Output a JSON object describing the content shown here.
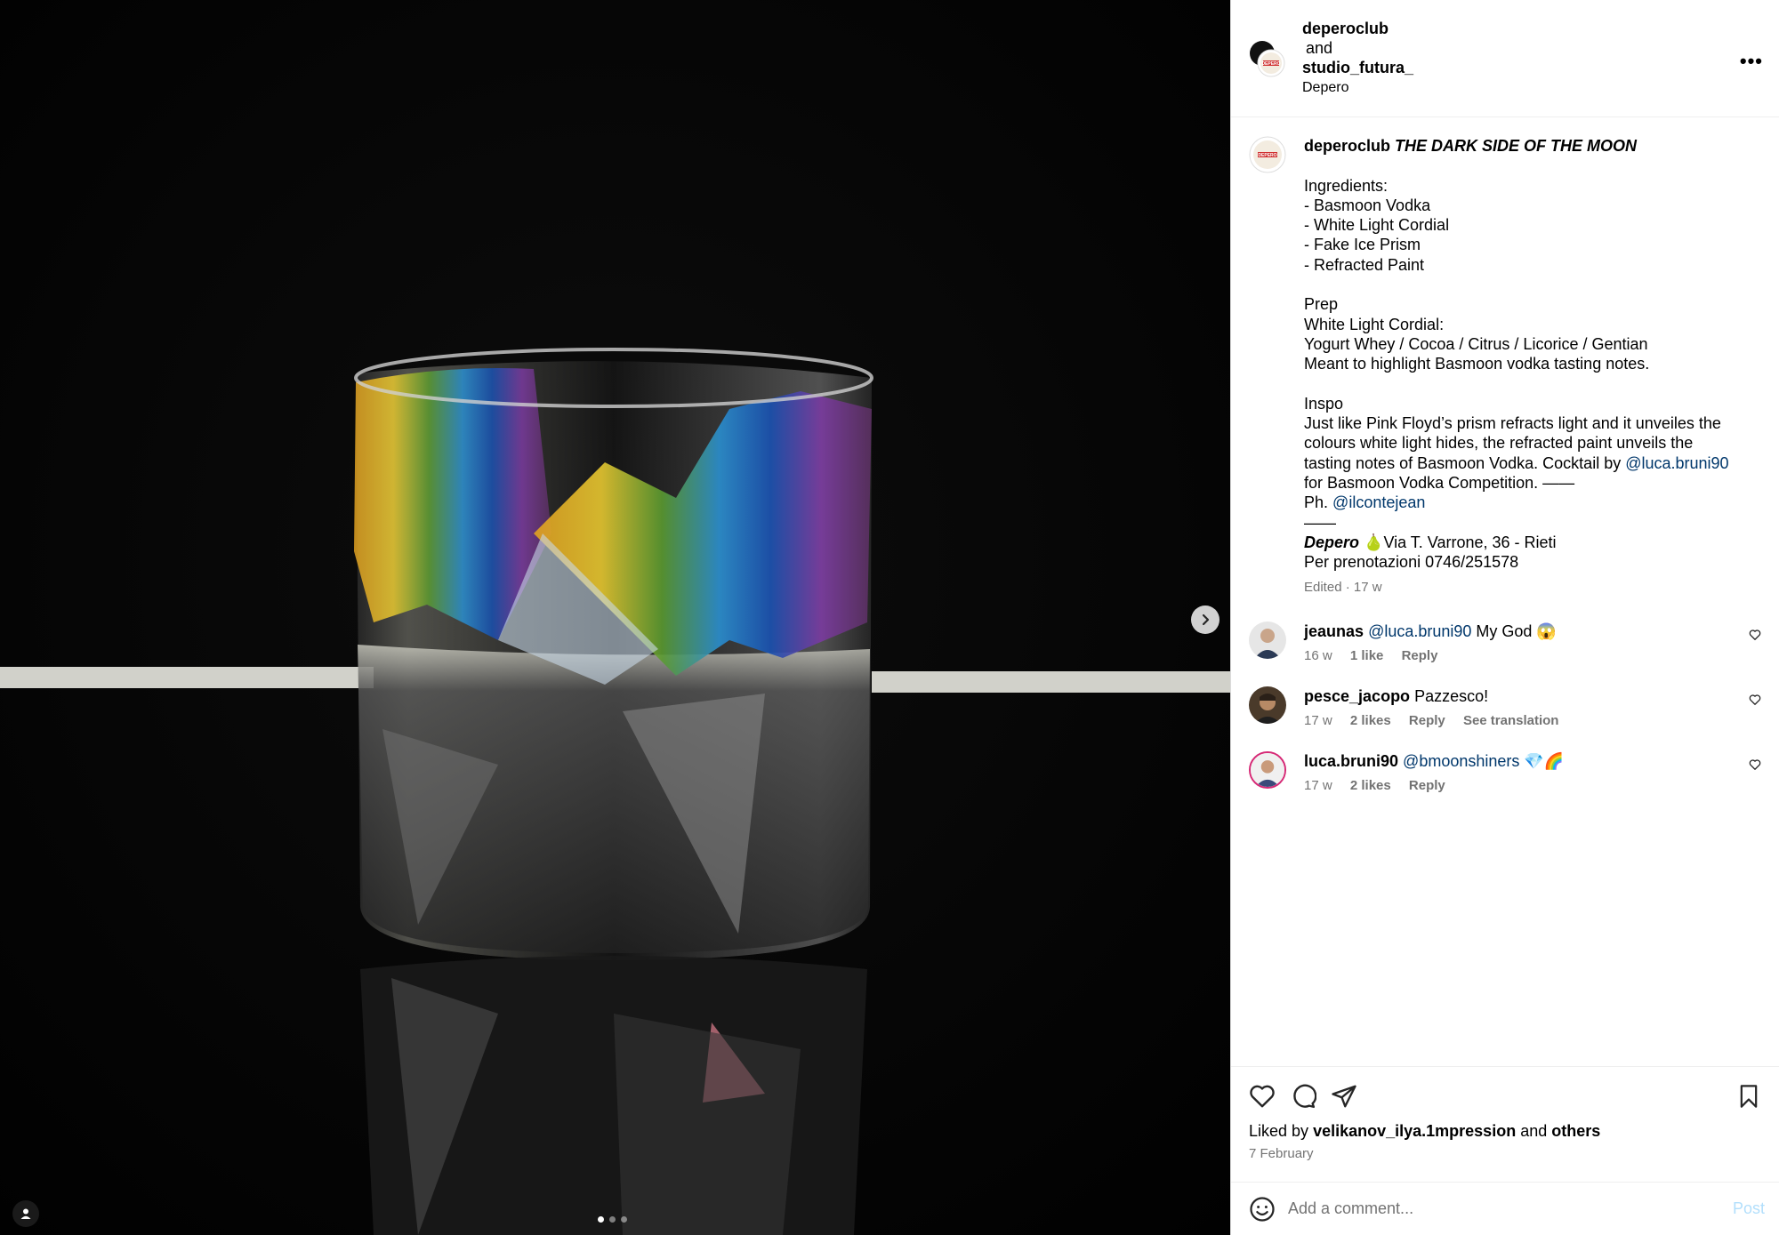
{
  "header": {
    "user1": "deperoclub",
    "and": "and",
    "user2": "studio_futura_",
    "location": "Depero",
    "more_label": "•••"
  },
  "caption": {
    "username": "deperoclub",
    "title": "THE DARK SIDE OF THE MOON",
    "lines": [
      "Ingredients:",
      "- Basmoon Vodka",
      "- White Light Cordial",
      "- Fake Ice Prism",
      "- Refracted Paint",
      "",
      "Prep",
      "White Light Cordial:",
      "Yogurt Whey / Cocoa / Citrus / Licorice / Gentian",
      "Meant to highlight Basmoon vodka tasting notes.",
      "",
      "Inspo",
      "Just like Pink Floyd’s prism refracts light and it unveiles the",
      "colours white light hides, the refracted paint unveils the",
      "tasting notes of Basmoon Vodka. Cocktail by"
    ],
    "mention1": "@luca.bruni90",
    "line_after_mention1": "for Basmoon Vodka Competition. ——",
    "ph_prefix": "Ph.",
    "mention2": "@ilcontejean",
    "divider": "——",
    "venue_name": "Depero",
    "venue_address": "🍐Via T. Varrone, 36 - Rieti",
    "booking": "Per prenotazioni 0746/251578",
    "meta": "Edited · 17 w"
  },
  "comments": [
    {
      "username": "jeaunas",
      "mention": "@luca.bruni90",
      "text": " My God 😱",
      "time": "16 w",
      "likes": "1 like",
      "reply": "Reply",
      "extra": ""
    },
    {
      "username": "pesce_jacopo",
      "mention": "",
      "text": "Pazzesco!",
      "time": "17 w",
      "likes": "2 likes",
      "reply": "Reply",
      "extra": "See translation"
    },
    {
      "username": "luca.bruni90",
      "mention": "@bmoonshiners",
      "text": " 💎🌈",
      "time": "17 w",
      "likes": "2 likes",
      "reply": "Reply",
      "extra": ""
    }
  ],
  "actions": {
    "liked_prefix": "Liked by",
    "liked_user": "velikanov_ilya.1mpression",
    "liked_and": "and",
    "liked_others": "others",
    "date": "7 February"
  },
  "add_comment": {
    "placeholder": "Add a comment...",
    "post_label": "Post"
  },
  "carousel": {
    "count": 3,
    "active_index": 0
  }
}
